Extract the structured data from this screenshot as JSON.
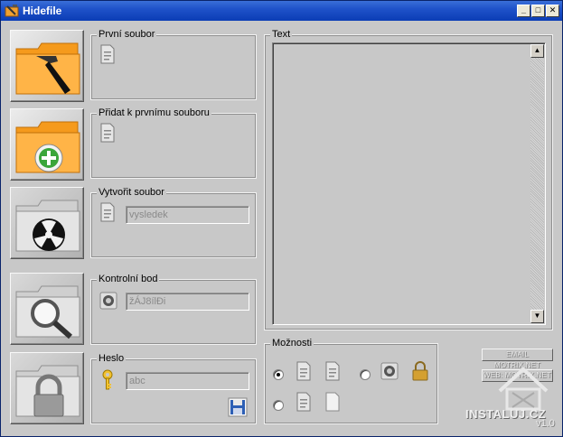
{
  "window": {
    "title": "Hidefile",
    "controls": {
      "minimize": "_",
      "maximize": "□",
      "close": "✕"
    }
  },
  "groups": {
    "prvni": {
      "label": "První soubor"
    },
    "pridat": {
      "label": "Přidat k prvnímu souboru"
    },
    "vytvorit": {
      "label": "Vytvořit soubor",
      "value": "vysledek"
    },
    "kontrolni": {
      "label": "Kontrolní bod",
      "value": "žÁJ8ílĐi"
    },
    "heslo": {
      "label": "Heslo",
      "value": "abc"
    },
    "text": {
      "label": "Text",
      "value": ""
    },
    "moznosti": {
      "label": "Možnosti",
      "options": [
        {
          "selected": true
        },
        {
          "selected": false
        },
        {
          "selected": false
        }
      ]
    }
  },
  "buttons": {
    "email": "EMAIL MOTRIX.NET",
    "web": "WEB: MOTRIX.NET"
  },
  "version": "v1.0",
  "watermark": "INSTALUJ.CZ",
  "icons": {
    "hammer": "hammer-folder-icon",
    "add": "add-folder-icon",
    "radiation": "radiation-folder-icon",
    "search": "magnifier-folder-icon",
    "lock": "padlock-folder-icon"
  }
}
